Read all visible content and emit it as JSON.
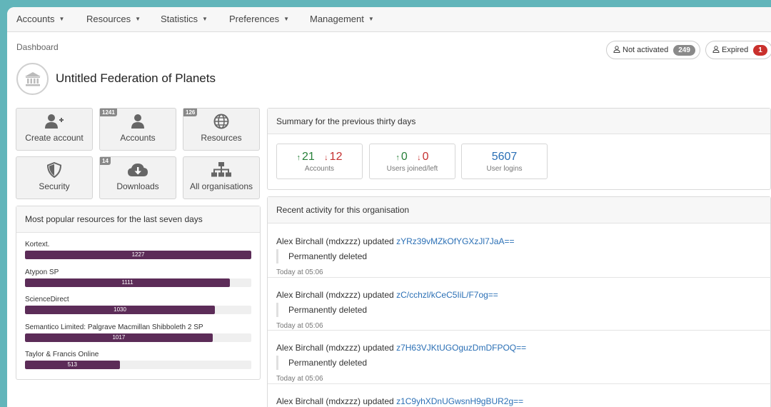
{
  "nav": {
    "items": [
      {
        "label": "Accounts"
      },
      {
        "label": "Resources"
      },
      {
        "label": "Statistics"
      },
      {
        "label": "Preferences"
      },
      {
        "label": "Management"
      }
    ]
  },
  "breadcrumb": "Dashboard",
  "status_pills": {
    "not_activated": {
      "label": "Not activated",
      "count": "249",
      "color": "#8a8a8a"
    },
    "expired": {
      "label": "Expired",
      "count": "1",
      "color": "#c9302c"
    }
  },
  "org": {
    "title": "Untitled Federation of Planets"
  },
  "tiles": [
    {
      "label": "Create account",
      "icon": "user-plus-icon",
      "count": ""
    },
    {
      "label": "Accounts",
      "icon": "user-icon",
      "count": "1241"
    },
    {
      "label": "Resources",
      "icon": "globe-icon",
      "count": "126"
    },
    {
      "label": "Security",
      "icon": "shield-icon",
      "count": ""
    },
    {
      "label": "Downloads",
      "icon": "cloud-download-icon",
      "count": "14"
    },
    {
      "label": "All organisations",
      "icon": "sitemap-icon",
      "count": ""
    }
  ],
  "popular": {
    "title": "Most popular resources for the last seven days",
    "max": 1227,
    "items": [
      {
        "name": "Kortext.",
        "value": 1227,
        "label": "1227"
      },
      {
        "name": "Atypon SP",
        "value": 1111,
        "label": "1111"
      },
      {
        "name": "ScienceDirect",
        "value": 1030,
        "label": "1030"
      },
      {
        "name": "Semantico Limited: Palgrave Macmillan Shibboleth 2 SP",
        "value": 1017,
        "label": "1017"
      },
      {
        "name": "Taylor & Francis Online",
        "value": 513,
        "label": "513"
      }
    ],
    "bar_color": "#5c2c58"
  },
  "summary": {
    "title": "Summary for the previous thirty days",
    "accounts": {
      "up": "21",
      "down": "12",
      "label": "Accounts"
    },
    "users": {
      "up": "0",
      "down": "0",
      "label": "Users joined/left"
    },
    "logins": {
      "value": "5607",
      "label": "User logins"
    }
  },
  "activity": {
    "title": "Recent activity for this organisation",
    "items": [
      {
        "actor": "Alex Birchall (mdxzzz) updated",
        "link": "zYRz39vMZkOfYGXzJl7JaA==",
        "detail": "Permanently deleted",
        "time": "Today at 05:06"
      },
      {
        "actor": "Alex Birchall (mdxzzz) updated",
        "link": "zC/cchzl/kCeC5IiL/F7og==",
        "detail": "Permanently deleted",
        "time": "Today at 05:06"
      },
      {
        "actor": "Alex Birchall (mdxzzz) updated",
        "link": "z7H63VJKtUGOguzDmDFPOQ==",
        "detail": "Permanently deleted",
        "time": "Today at 05:06"
      },
      {
        "actor": "Alex Birchall (mdxzzz) updated",
        "link": "z1C9yhXDnUGwsnH9gBUR2g==",
        "detail": "",
        "time": ""
      }
    ]
  }
}
